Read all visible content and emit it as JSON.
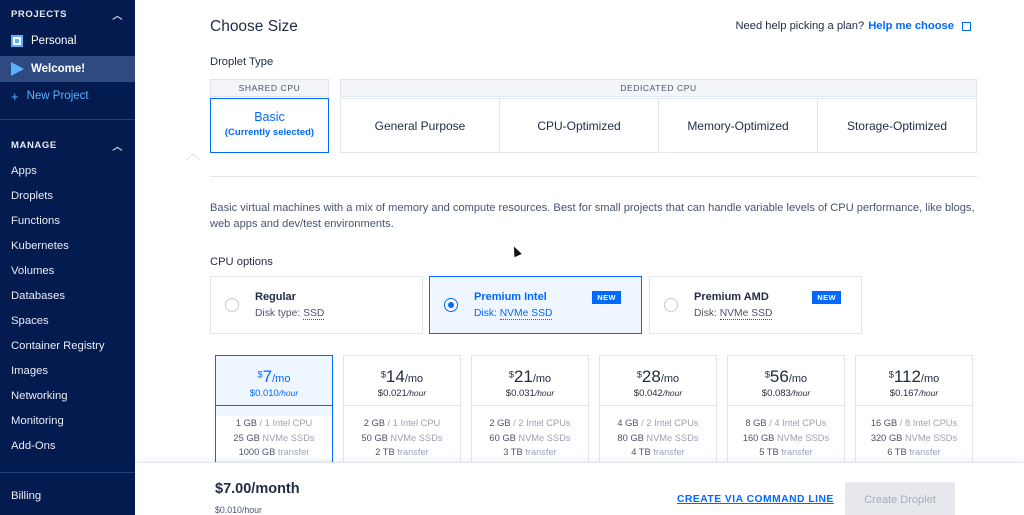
{
  "sidebar": {
    "projects_heading": "PROJECTS",
    "projects": [
      {
        "label": "Personal"
      },
      {
        "label": "Welcome!"
      },
      {
        "label": "New Project"
      }
    ],
    "manage_heading": "MANAGE",
    "items": [
      "Apps",
      "Droplets",
      "Functions",
      "Kubernetes",
      "Volumes",
      "Databases",
      "Spaces",
      "Container Registry",
      "Images",
      "Networking",
      "Monitoring",
      "Add-Ons"
    ],
    "billing": "Billing"
  },
  "header": {
    "title": "Choose Size",
    "help_prefix": "Need help picking a plan?",
    "help_link": "Help me choose"
  },
  "droplet_type": {
    "heading": "Droplet Type",
    "shared_label": "SHARED CPU",
    "basic_title": "Basic",
    "basic_sub": "(Currently selected)",
    "dedicated_label": "DEDICATED CPU",
    "dedicated_options": [
      "General Purpose",
      "CPU-Optimized",
      "Memory-Optimized",
      "Storage-Optimized"
    ]
  },
  "description": "Basic virtual machines with a mix of memory and compute resources. Best for small projects that can handle variable levels of CPU performance, like blogs, web apps and dev/test environments.",
  "cpu_options": {
    "heading": "CPU options",
    "options": [
      {
        "name": "Regular",
        "disk_prefix": "Disk type: ",
        "disk": "SSD",
        "badge": ""
      },
      {
        "name": "Premium Intel",
        "disk_prefix": "Disk: ",
        "disk": "NVMe SSD",
        "badge": "NEW"
      },
      {
        "name": "Premium AMD",
        "disk_prefix": "Disk: ",
        "disk": "NVMe SSD",
        "badge": "NEW"
      }
    ],
    "selected": "Premium Intel"
  },
  "plans": [
    {
      "dollar": "$",
      "price": "7",
      "per": "/mo",
      "hourly": "$0.010",
      "per_hour": "/hour",
      "mem": "1 GB",
      "cpu": "/ 1 Intel CPU",
      "disk": "25 GB",
      "disk_type": "NVMe SSDs",
      "transfer": "1000 GB",
      "transfer_label": "transfer"
    },
    {
      "dollar": "$",
      "price": "14",
      "per": "/mo",
      "hourly": "$0.021",
      "per_hour": "/hour",
      "mem": "2 GB",
      "cpu": "/ 1 Intel CPU",
      "disk": "50 GB",
      "disk_type": "NVMe SSDs",
      "transfer": "2 TB",
      "transfer_label": "transfer"
    },
    {
      "dollar": "$",
      "price": "21",
      "per": "/mo",
      "hourly": "$0.031",
      "per_hour": "/hour",
      "mem": "2 GB",
      "cpu": "/ 2 Intel CPUs",
      "disk": "60 GB",
      "disk_type": "NVMe SSDs",
      "transfer": "3 TB",
      "transfer_label": "transfer"
    },
    {
      "dollar": "$",
      "price": "28",
      "per": "/mo",
      "hourly": "$0.042",
      "per_hour": "/hour",
      "mem": "4 GB",
      "cpu": "/ 2 Intel CPUs",
      "disk": "80 GB",
      "disk_type": "NVMe SSDs",
      "transfer": "4 TB",
      "transfer_label": "transfer"
    },
    {
      "dollar": "$",
      "price": "56",
      "per": "/mo",
      "hourly": "$0.083",
      "per_hour": "/hour",
      "mem": "8 GB",
      "cpu": "/ 4 Intel CPUs",
      "disk": "160 GB",
      "disk_type": "NVMe SSDs",
      "transfer": "5 TB",
      "transfer_label": "transfer"
    },
    {
      "dollar": "$",
      "price": "112",
      "per": "/mo",
      "hourly": "$0.167",
      "per_hour": "/hour",
      "mem": "16 GB",
      "cpu": "/ 8 Intel CPUs",
      "disk": "320 GB",
      "disk_type": "NVMe SSDs",
      "transfer": "6 TB",
      "transfer_label": "transfer"
    }
  ],
  "footer": {
    "price": "$7.00/month",
    "hourly": "$0.010/hour",
    "cli_link": "CREATE VIA COMMAND LINE",
    "create_button": "Create Droplet"
  },
  "colors": {
    "sidebar_bg": "#031b4e",
    "accent": "#0069ff",
    "sidebar_active": "#2f4a80"
  }
}
